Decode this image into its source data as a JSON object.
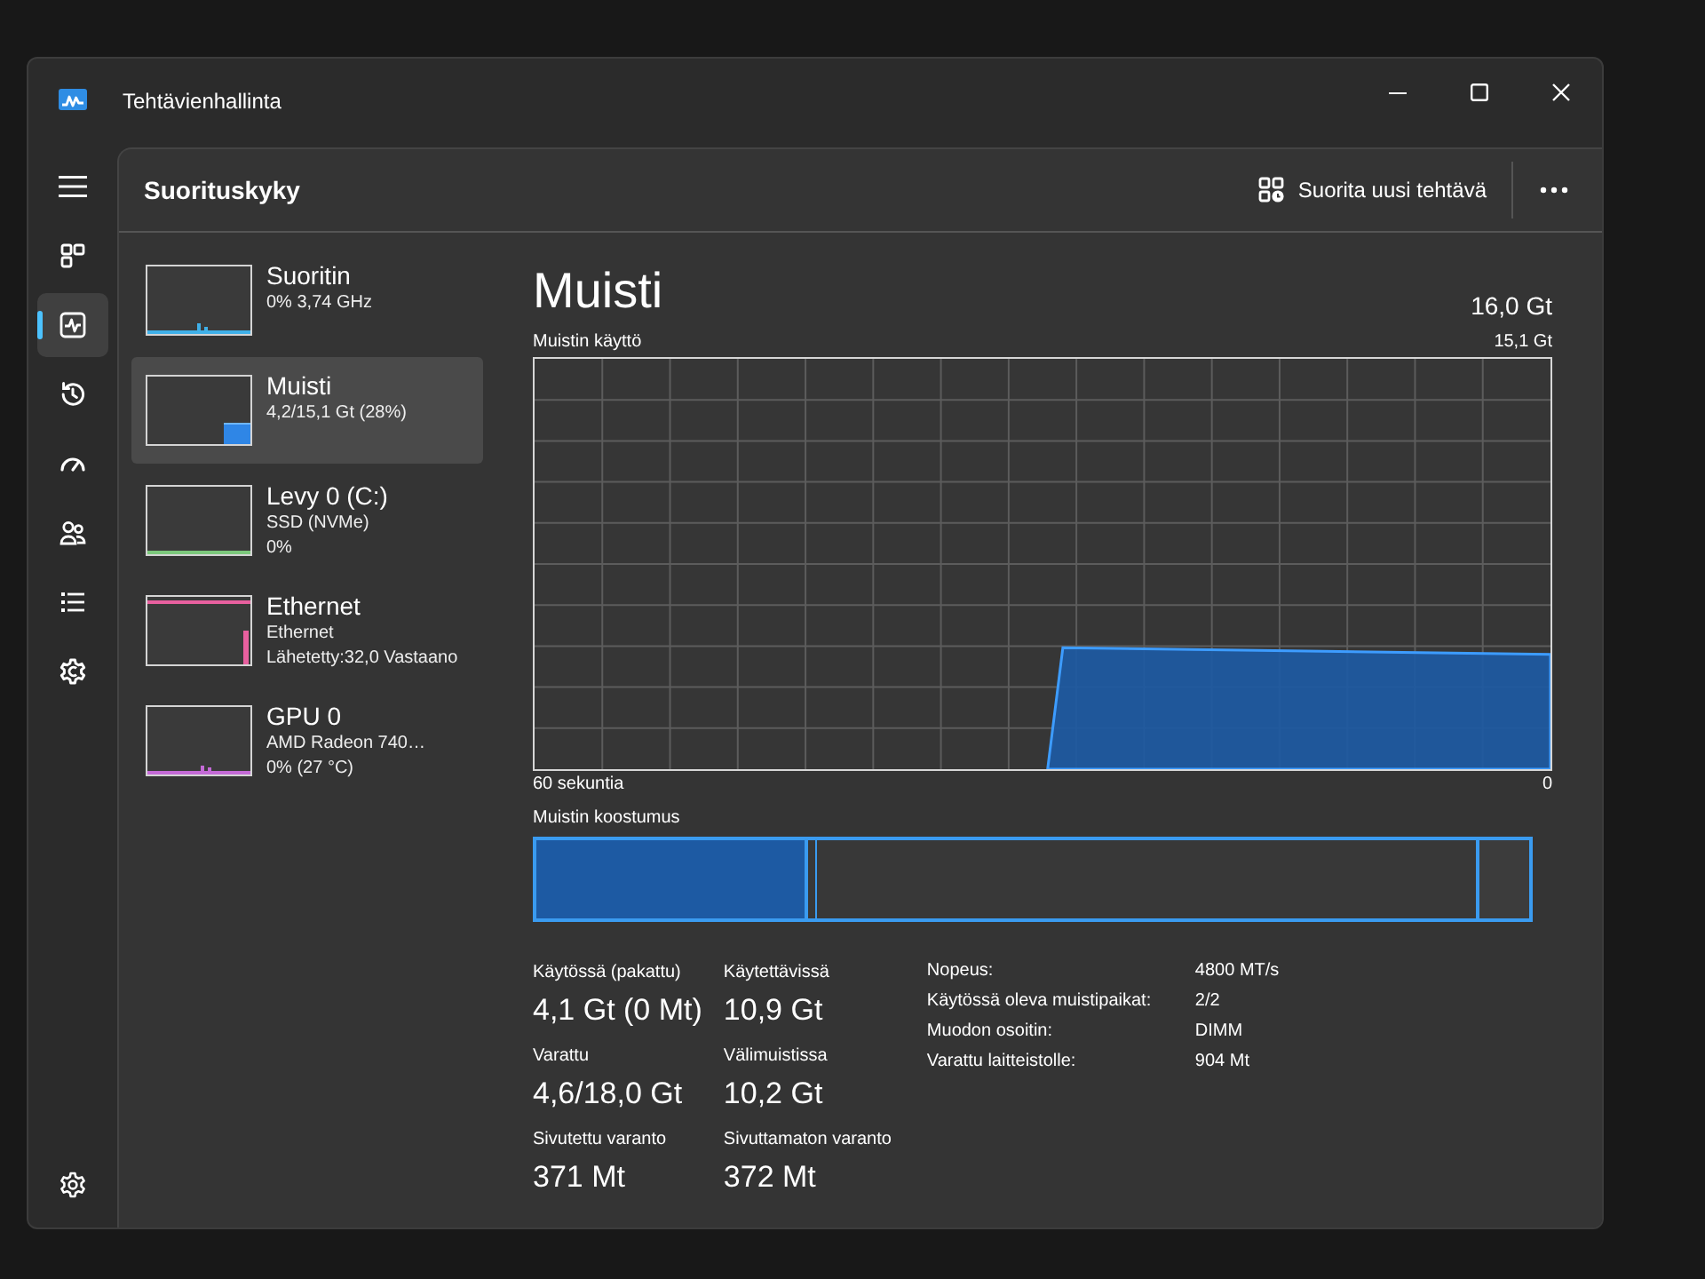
{
  "window": {
    "title": "Tehtävienhallinta"
  },
  "nav": [
    {
      "kind": "processes",
      "selected": false
    },
    {
      "kind": "performance",
      "selected": true
    },
    {
      "kind": "app_history",
      "selected": false
    },
    {
      "kind": "startup",
      "selected": false
    },
    {
      "kind": "users",
      "selected": false
    },
    {
      "kind": "details",
      "selected": false
    },
    {
      "kind": "services",
      "selected": false
    }
  ],
  "nav_bottom": [
    {
      "kind": "settings",
      "selected": false
    }
  ],
  "header": {
    "title": "Suorituskyky",
    "run_task_button": "Suorita uusi tehtävä"
  },
  "devices": [
    {
      "kind": "cpu",
      "name": "Suoritin",
      "details": [
        "0% 3,74 GHz"
      ],
      "color": "#3fb0e8",
      "selected": false
    },
    {
      "kind": "memory",
      "name": "Muisti",
      "details": [
        "4,2/15,1 Gt (28%)"
      ],
      "color": "#2f86e6",
      "selected": true
    },
    {
      "kind": "disk",
      "name": "Levy 0 (C:)",
      "details": [
        "SSD (NVMe)",
        "0%"
      ],
      "color": "#7cc87c",
      "selected": false
    },
    {
      "kind": "ethernet",
      "name": "Ethernet",
      "details": [
        "Ethernet",
        "Lähetetty:32,0 Vastaano"
      ],
      "color": "#e8609f",
      "selected": false
    },
    {
      "kind": "gpu",
      "name": "GPU 0",
      "details": [
        "AMD Radeon 740…",
        "0% (27 °C)"
      ],
      "color": "#c46ad6",
      "selected": false
    }
  ],
  "detail": {
    "title": "Muisti",
    "total": "16,0 Gt",
    "usage_chart": {
      "label": "Muistin käyttö",
      "max": "15,1 Gt",
      "x_start": "60 sekuntia",
      "x_end": "0"
    },
    "composition": {
      "label": "Muistin koostumus"
    },
    "stats": [
      {
        "label": "Käytössä (pakattu)",
        "value": "4,1 Gt (0 Mt)"
      },
      {
        "label": "Käytettävissä",
        "value": "10,9 Gt"
      },
      {
        "label": "Varattu",
        "value": "4,6/18,0 Gt"
      },
      {
        "label": "Välimuistissa",
        "value": "10,2 Gt"
      },
      {
        "label": "Sivutettu varanto",
        "value": "371 Mt"
      },
      {
        "label": "Sivuttamaton varanto",
        "value": "372 Mt"
      }
    ],
    "properties": [
      {
        "label": "Nopeus:",
        "value": "4800 MT/s"
      },
      {
        "label": "Käytössä oleva muistipaikat:",
        "value": "2/2"
      },
      {
        "label": "Muodon osoitin:",
        "value": "DIMM"
      },
      {
        "label": "Varattu laitteistolle:",
        "value": "904 Mt"
      }
    ]
  }
}
